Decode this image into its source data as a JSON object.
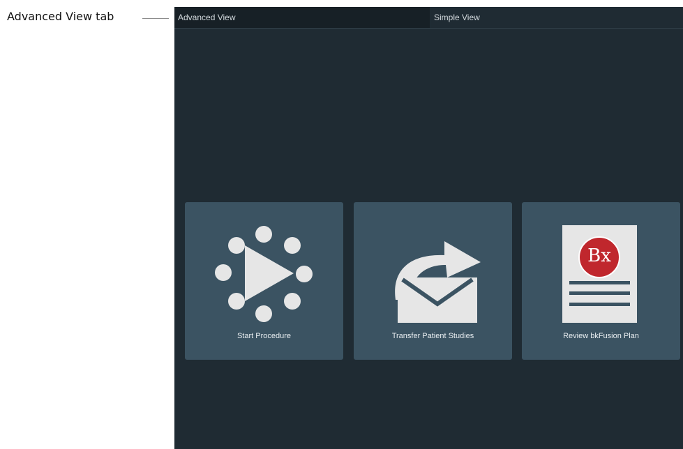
{
  "annotation": {
    "label": "Advanced View tab"
  },
  "tabs": [
    {
      "label": "Advanced View",
      "active": true
    },
    {
      "label": "Simple View",
      "active": false
    }
  ],
  "tiles": [
    {
      "label": "Start Procedure",
      "icon": "start-procedure-icon"
    },
    {
      "label": "Transfer Patient Studies",
      "icon": "transfer-studies-icon"
    },
    {
      "label": "Review bkFusion Plan",
      "icon": "bx-document-icon",
      "badge_text": "Bx"
    }
  ],
  "colors": {
    "background": "#1f2b33",
    "tile": "#3b5362",
    "icon": "#e6e6e6",
    "badge": "#c0272d"
  }
}
